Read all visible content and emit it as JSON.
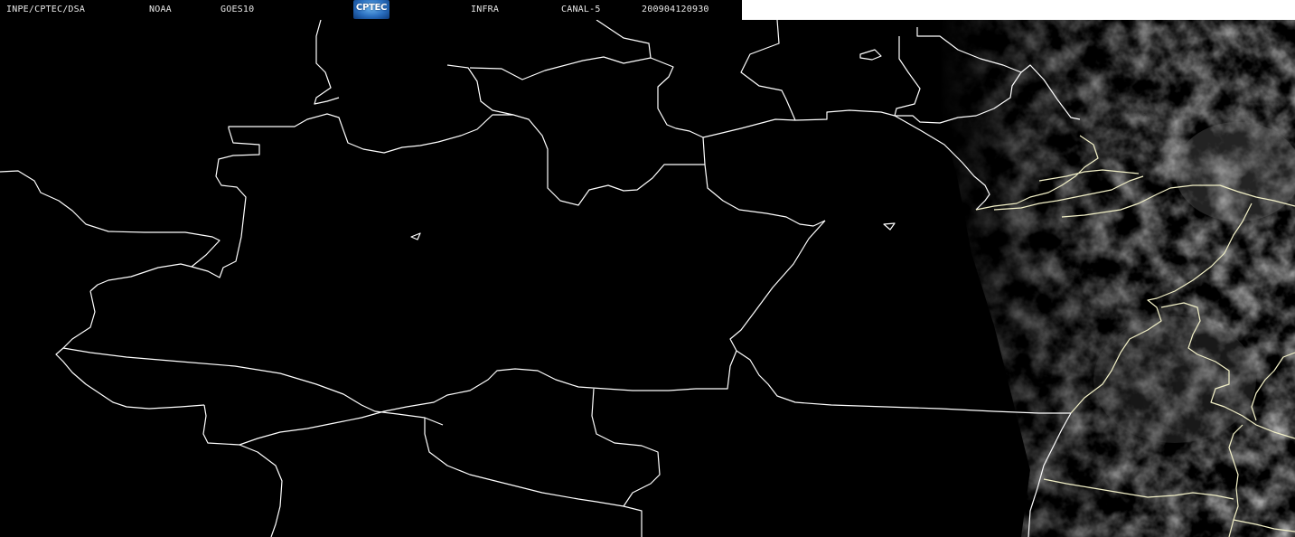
{
  "header": {
    "source": "INPE/CPTEC/DSA",
    "agency": "NOAA",
    "satellite": "GOES10",
    "logo_text": "CPTEC",
    "image_type": "INFRA",
    "channel": "CANAL-5",
    "timestamp": "200904120930"
  },
  "colors": {
    "background": "#000000",
    "borders": "#ffffff",
    "header_text": "#e8e8e8",
    "cloud_tint": "#9a9a9a"
  }
}
